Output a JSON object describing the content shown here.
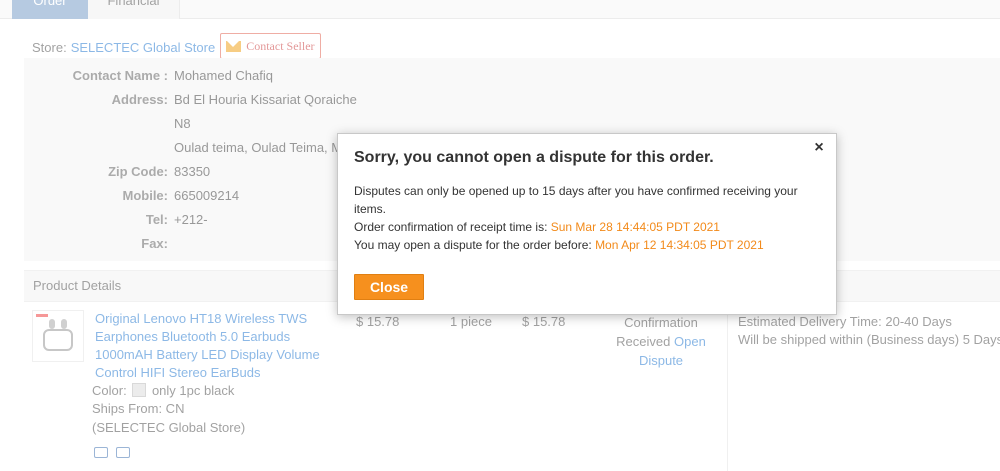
{
  "tabs": [
    {
      "label": "Order"
    },
    {
      "label": "Financial"
    }
  ],
  "store": {
    "label": "Store:",
    "name": "SELECTEC Global Store",
    "contact_seller": "Contact Seller"
  },
  "address": {
    "contact_name_label": "Contact Name :",
    "contact_name": "Mohamed Chafiq",
    "address_label": "Address:",
    "address_line1": "Bd El Houria Kissariat Qoraiche",
    "address_line2": "N8",
    "address_line3": "Oulad teima, Oulad Teima, M",
    "zip_label": "Zip Code:",
    "zip": "83350",
    "mobile_label": "Mobile:",
    "mobile": "665009214",
    "tel_label": "Tel:",
    "tel": "+212-",
    "fax_label": "Fax:",
    "fax": ""
  },
  "product_details": {
    "header": "Product Details",
    "title": "Original Lenovo HT18 Wireless TWS Earphones Bluetooth 5.0 Earbuds 1000mAH Battery LED Display Volume Control HIFI Stereo EarBuds",
    "color_label": "Color:",
    "color_value": "only 1pc black",
    "ships_from": "Ships From: CN",
    "store_note": "(SELECTEC Global Store)",
    "price": "$ 15.78",
    "quantity": "1 piece",
    "total": "$ 15.78",
    "status_line1": "Confirmation",
    "status_line2": "Received",
    "open_dispute_1": "Open",
    "open_dispute_2": "Dispute",
    "delivery_time": "Estimated Delivery Time: 20-40 Days",
    "shipping_note": "Will be shipped within (Business days) 5 Days"
  },
  "modal": {
    "title": "Sorry, you cannot open a dispute for this order.",
    "close_x": "×",
    "line1": "Disputes can only be opened up to 15 days after you have confirmed receiving your items.",
    "line2_prefix": "Order confirmation of receipt time is:",
    "line2_time": "Sun Mar 28 14:44:05 PDT 2021",
    "line3_prefix": "You may open a dispute for the order before:",
    "line3_time": "Mon Apr 12 14:34:05 PDT 2021",
    "close_button": "Close"
  },
  "colors": {
    "link": "#2f7fd1",
    "accent_orange": "#f6901e",
    "highlight_orange": "#f28a1a"
  }
}
